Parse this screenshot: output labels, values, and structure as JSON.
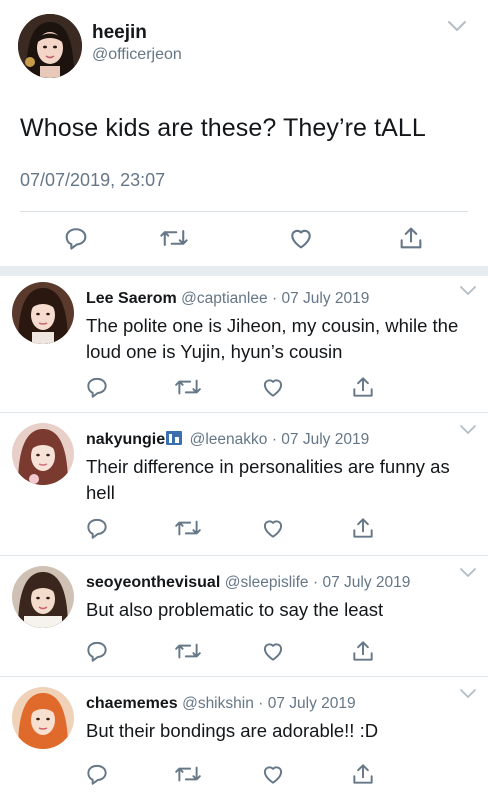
{
  "main": {
    "name": "heejin",
    "handle": "@officerjeon",
    "text": "Whose kids are these? They’re tALL",
    "timestamp": "07/07/2019, 23:07"
  },
  "icons": {
    "reply": "reply-icon",
    "retweet": "retweet-icon",
    "like": "heart-icon",
    "share": "share-icon",
    "menu": "chevron-down-icon"
  },
  "colors": {
    "text": "#14171a",
    "muted": "#657786",
    "divider": "#e6ecf0"
  },
  "replies": [
    {
      "name": "Lee Saerom",
      "handle": "@captianlee",
      "date": "07 July 2019",
      "text": "The polite one is Jiheon, my cousin, while the loud one is Yujin, hyun’s cousin"
    },
    {
      "name": "nakyungie",
      "badge": "cityscape-emoji",
      "handle": "@leenakko",
      "date": "07 July 2019",
      "text": "Their difference in personalities are funny as hell"
    },
    {
      "name": "seoyeonthevisual",
      "handle": "@sleepislife",
      "date": "07 July 2019",
      "text": "But also problematic to say the least"
    },
    {
      "name": "chaememes",
      "handle": "@shikshin",
      "date": "07 July 2019",
      "text": "But their bondings are adorable!! :D"
    }
  ]
}
